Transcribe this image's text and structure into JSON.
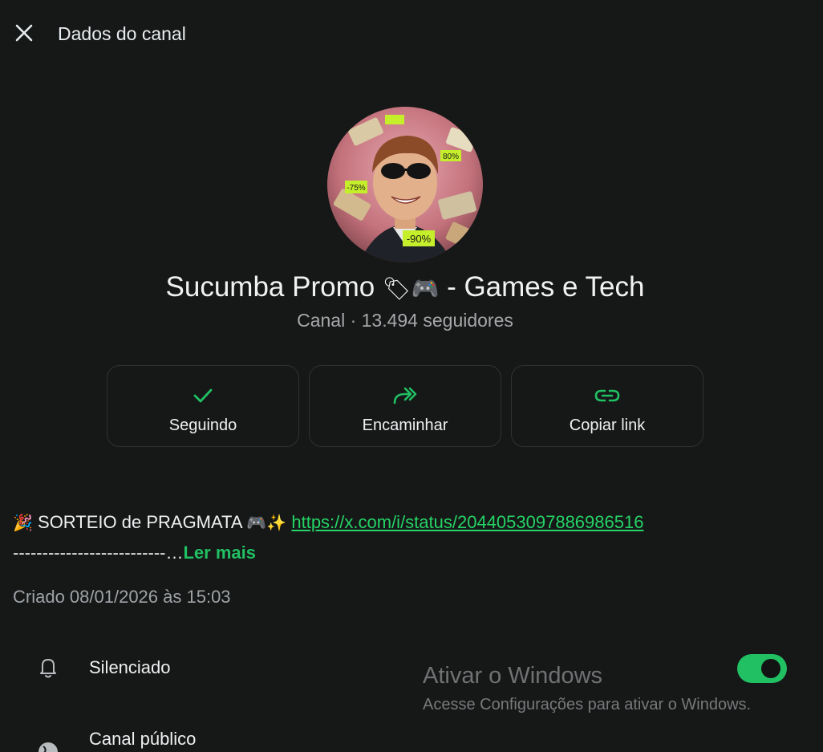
{
  "header": {
    "title": "Dados do canal",
    "close_icon": "close-icon"
  },
  "channel": {
    "name_prefix": "Sucumba Promo ",
    "name_emoji": "🏷🎮",
    "name_suffix": " - Games e Tech",
    "meta": "Canal · 13.494 seguidores",
    "avatar_labels": [
      "-90%",
      "80%",
      "-75%",
      "-90%"
    ]
  },
  "actions": [
    {
      "label": "Seguindo",
      "icon": "check-icon"
    },
    {
      "label": "Encaminhar",
      "icon": "forward-icon"
    },
    {
      "label": "Copiar link",
      "icon": "link-icon"
    }
  ],
  "description": {
    "emoji_start": "🎉",
    "text": " SORTEIO de PRAGMATA ",
    "emoji_end": "🎮✨",
    "link": "https://x.com/i/status/2044053097886986516",
    "dashes": "--------------------------…",
    "read_more": "Ler mais"
  },
  "created": "Criado 08/01/2026 às 15:03",
  "settings": {
    "muted_label": "Silenciado",
    "muted_enabled": true,
    "public_label": "Canal público"
  },
  "watermark": {
    "title": "Ativar o Windows",
    "subtitle": "Acesse Configurações para ativar o Windows."
  },
  "colors": {
    "background": "#161717",
    "accent": "#21c063",
    "text": "#e9edef",
    "muted_text": "#a5a8aa"
  }
}
